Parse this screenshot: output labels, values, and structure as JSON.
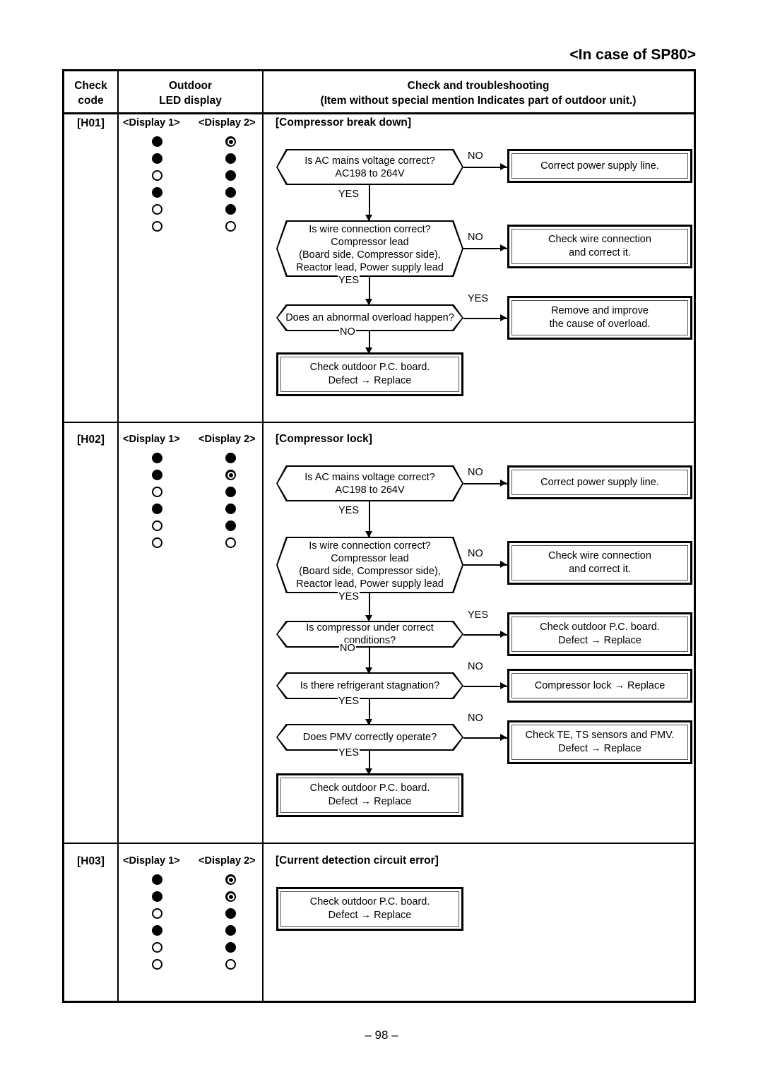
{
  "document": {
    "title": "<In case of SP80>",
    "page_number": "– 98 –"
  },
  "table": {
    "headers": {
      "check_code": "Check\ncode",
      "check_code_line1": "Check",
      "check_code_line2": "code",
      "led_display_line1": "Outdoor",
      "led_display_line2": "LED display",
      "troubleshooting_line1": "Check and troubleshooting",
      "troubleshooting_line2": "(Item without special mention Indicates part of outdoor unit.)"
    },
    "display_labels": {
      "display1": "<Display 1>",
      "display2": "<Display 2>"
    },
    "rows": [
      {
        "code": "[H01]",
        "error_name": "[Compressor break down]",
        "led": {
          "display1": [
            "on",
            "on",
            "off",
            "on",
            "off",
            "off"
          ],
          "display2": [
            "blink",
            "on",
            "on",
            "on",
            "on",
            "off"
          ]
        },
        "flow": {
          "decisions": [
            {
              "id": "h01-d1",
              "text": [
                "Is AC mains voltage correct?",
                "AC198 to 264V"
              ],
              "branch_label": "NO",
              "down_label": "YES"
            },
            {
              "id": "h01-d2",
              "text": [
                "Is wire connection correct?",
                "Compressor lead",
                "(Board side, Compressor side),",
                "Reactor lead, Power supply lead"
              ],
              "branch_label": "NO",
              "down_label": "YES"
            },
            {
              "id": "h01-d3",
              "text": [
                "Does an abnormal overload happen?"
              ],
              "branch_label": "YES",
              "down_label": "NO"
            }
          ],
          "actions": [
            {
              "id": "h01-a1",
              "text": [
                "Correct power supply line."
              ]
            },
            {
              "id": "h01-a2",
              "text": [
                "Check wire connection",
                "and correct it."
              ]
            },
            {
              "id": "h01-a3",
              "text": [
                "Remove and improve",
                "the cause of overload."
              ]
            },
            {
              "id": "h01-a4",
              "text": [
                "Check outdoor P.C. board.",
                "Defect → Replace"
              ]
            }
          ]
        }
      },
      {
        "code": "[H02]",
        "error_name": "[Compressor lock]",
        "led": {
          "display1": [
            "on",
            "on",
            "off",
            "on",
            "off",
            "off"
          ],
          "display2": [
            "on",
            "blink",
            "on",
            "on",
            "on",
            "off"
          ]
        },
        "flow": {
          "decisions": [
            {
              "id": "h02-d1",
              "text": [
                "Is AC mains voltage correct?",
                "AC198 to 264V"
              ],
              "branch_label": "NO",
              "down_label": "YES"
            },
            {
              "id": "h02-d2",
              "text": [
                "Is wire connection correct?",
                "Compressor lead",
                "(Board side, Compressor side),",
                "Reactor lead, Power supply lead"
              ],
              "branch_label": "NO",
              "down_label": "YES"
            },
            {
              "id": "h02-d3",
              "text": [
                "Is compressor under correct conditions?"
              ],
              "branch_label": "YES",
              "down_label": "NO"
            },
            {
              "id": "h02-d4",
              "text": [
                "Is there refrigerant stagnation?"
              ],
              "branch_label": "NO",
              "down_label": "YES"
            },
            {
              "id": "h02-d5",
              "text": [
                "Does PMV correctly operate?"
              ],
              "branch_label": "NO",
              "down_label": "YES"
            }
          ],
          "actions": [
            {
              "id": "h02-a1",
              "text": [
                "Correct power supply line."
              ]
            },
            {
              "id": "h02-a2",
              "text": [
                "Check wire connection",
                "and correct it."
              ]
            },
            {
              "id": "h02-a3",
              "text": [
                "Check outdoor P.C. board.",
                "Defect → Replace"
              ]
            },
            {
              "id": "h02-a4",
              "text": [
                "Compressor lock → Replace"
              ]
            },
            {
              "id": "h02-a5",
              "text": [
                "Check TE, TS sensors and PMV.",
                "Defect → Replace"
              ]
            },
            {
              "id": "h02-a6",
              "text": [
                "Check outdoor P.C. board.",
                "Defect → Replace"
              ]
            }
          ]
        }
      },
      {
        "code": "[H03]",
        "error_name": "[Current detection circuit error]",
        "led": {
          "display1": [
            "on",
            "on",
            "off",
            "on",
            "off",
            "off"
          ],
          "display2": [
            "blink",
            "blink",
            "on",
            "on",
            "on",
            "off"
          ]
        },
        "flow": {
          "decisions": [],
          "actions": [
            {
              "id": "h03-a1",
              "text": [
                "Check outdoor P.C. board.",
                "Defect → Replace"
              ]
            }
          ]
        }
      }
    ]
  }
}
